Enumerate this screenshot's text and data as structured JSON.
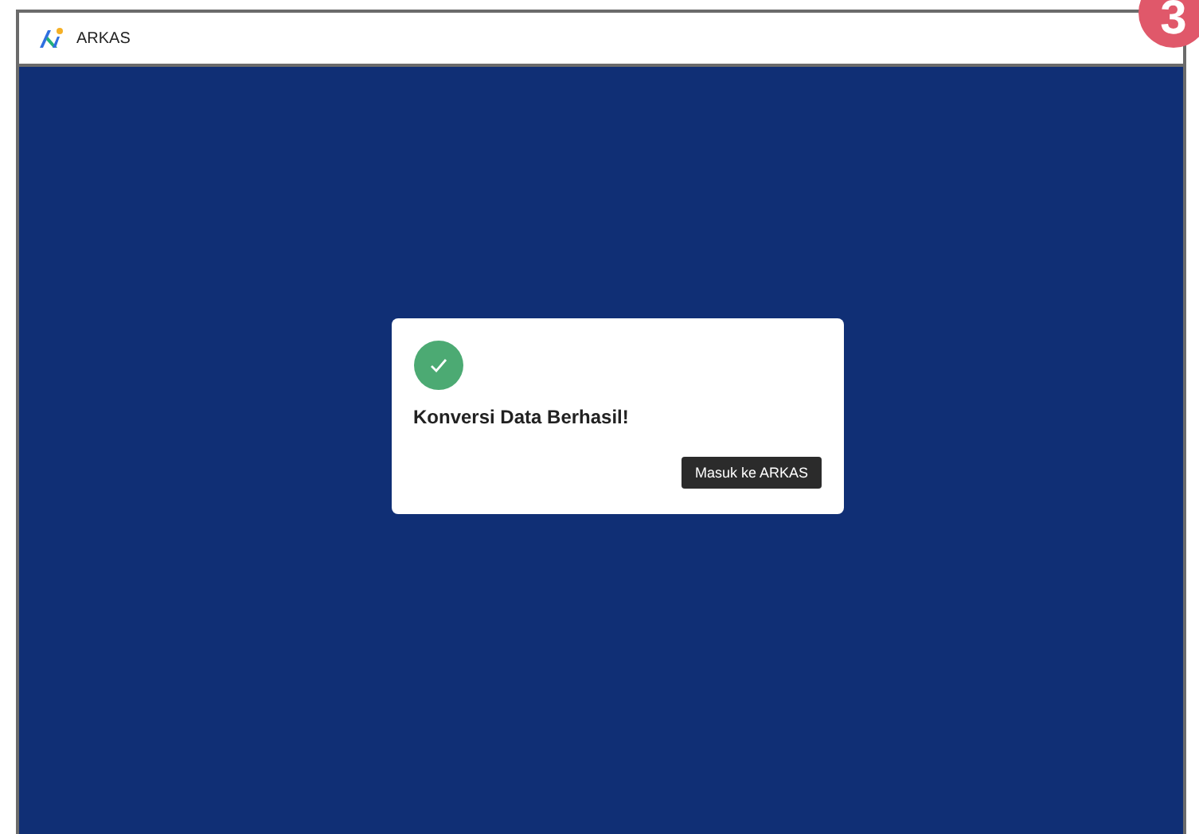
{
  "header": {
    "app_name": "ARKAS"
  },
  "step_badge": "3",
  "dialog": {
    "success": true,
    "message": "Konversi Data Berhasil!",
    "button": "Masuk ke ARKAS"
  }
}
